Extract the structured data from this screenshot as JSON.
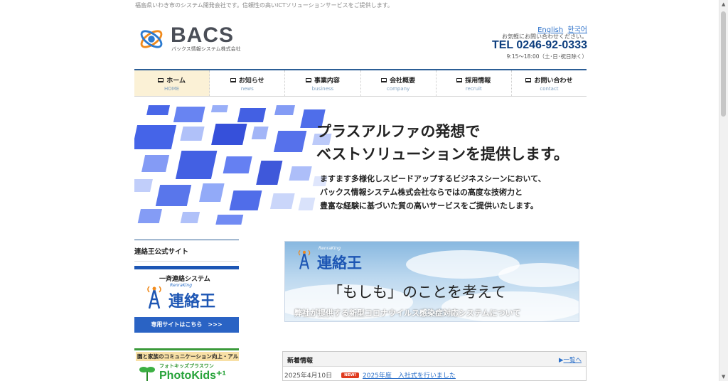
{
  "header": {
    "tagline": "福島県いわき市のシステム開発会社です。信頼性の高いICTソリューションサービスをご提供します。",
    "logo_word": "BACS",
    "logo_sub": "バックス情報システム株式会社",
    "lang_en": "English",
    "lang_ko": "한국어",
    "contact_note": "お気軽にお問い合わせください。",
    "tel": "TEL 0246-92-0333",
    "hours": "9:15～18:00（土･日･祝日除く）"
  },
  "nav": [
    {
      "ja": "ホーム",
      "en": "HOME"
    },
    {
      "ja": "お知らせ",
      "en": "news"
    },
    {
      "ja": "事業内容",
      "en": "business"
    },
    {
      "ja": "会社概要",
      "en": "company"
    },
    {
      "ja": "採用情報",
      "en": "recruit"
    },
    {
      "ja": "お問い合わせ",
      "en": "contact"
    }
  ],
  "hero": {
    "headline1": "プラスアルファの発想で",
    "headline2": "ベストソリューションを提供します。",
    "body1": "ますます多様化しスピードアップするビジネスシーンにおいて、",
    "body2": "バックス情報システム株式会社ならではの高度な技術力と",
    "body3": "豊富な経験に基づいた質の高いサービスをご提供いたします。"
  },
  "sidebar": {
    "title": "連絡王公式サイト",
    "bannerA": {
      "line1": "一斉連絡システム",
      "renraking": "RenraKing",
      "name": "連絡王",
      "bar": "専用サイトはこちら　>>>"
    },
    "bannerB": {
      "top": "園と家族のコミュニケーション向上・アルバム制作支援サービス",
      "line2": "フォトキッズプラスワン",
      "big": "PhotoKids⁺¹"
    }
  },
  "covid_banner": {
    "renraking": "RenraKing",
    "name": "連絡王",
    "headline": "「もしも」のことを考えて",
    "sub": "弊社が提供する新型コロナウイルス感染症対応システムについて"
  },
  "news": {
    "title": "新着情報",
    "more": "一覧へ",
    "items": [
      {
        "date": "2025年4月10日",
        "badge": "NEW!",
        "text": "2025年度　入社式を行いました"
      }
    ]
  },
  "colors": {
    "nav_border": "#2c5e96",
    "accent_blue": "#1d56b4",
    "link": "#2a6fc9",
    "new_badge": "#e03a1e"
  }
}
